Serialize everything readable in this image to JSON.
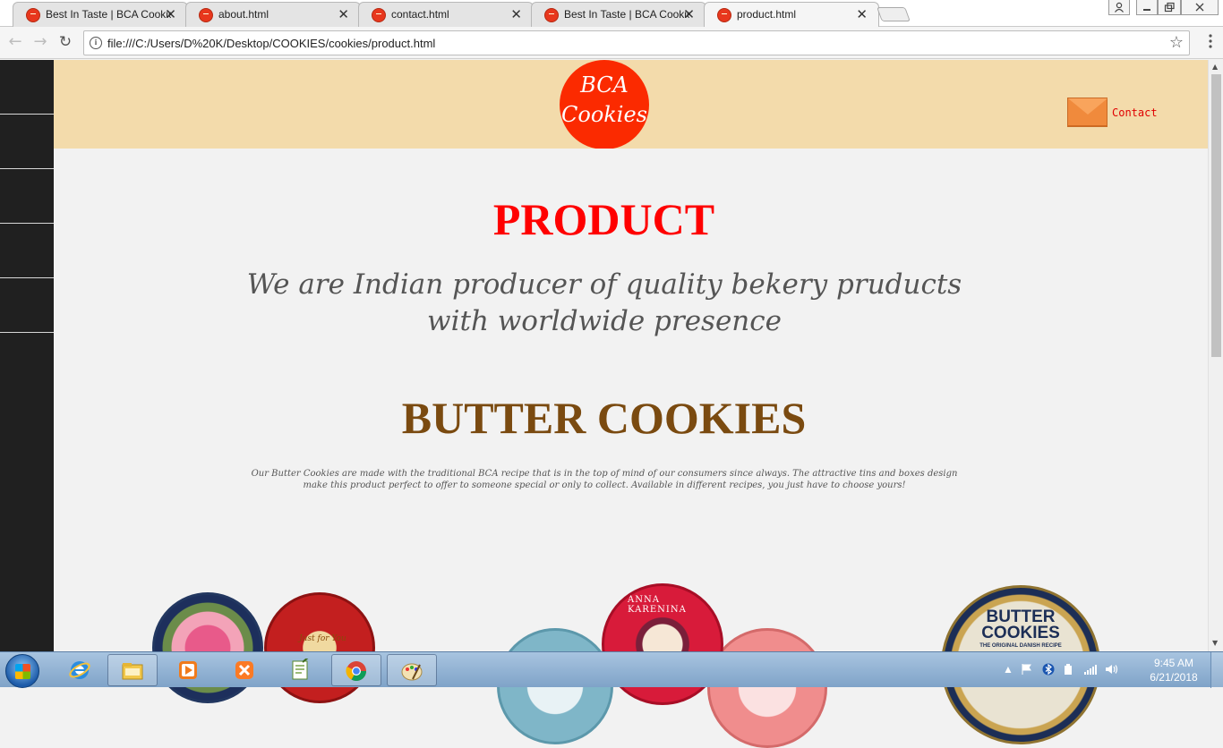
{
  "browser": {
    "tabs": [
      {
        "title": "Best In Taste | BCA Cookies",
        "active": false
      },
      {
        "title": "about.html",
        "active": false
      },
      {
        "title": "contact.html",
        "active": false
      },
      {
        "title": "Best In Taste | BCA Cookies",
        "active": false
      },
      {
        "title": "product.html",
        "active": true
      }
    ],
    "url": "file:///C:/Users/D%20K/Desktop/COOKIES/cookies/product.html",
    "close_glyph": "✕",
    "back_glyph": "←",
    "forward_glyph": "→",
    "reload_glyph": "↻",
    "info_glyph": "i",
    "star_glyph": "☆"
  },
  "site": {
    "logo_line1": "BCA",
    "logo_line2": "Cookies",
    "contact_label": "Contact",
    "sidebar_items": 5,
    "heading": "PRODUCT",
    "tagline": "We are Indian producer of quality bekery pruducts with worldwide presence",
    "section_heading": "BUTTER COOKIES",
    "description": "Our Butter Cookies are made with the traditional BCA recipe that is in the top of mind of our consumers since always. The attractive tins and boxes design make this product perfect to offer to someone special or only to collect. Available in different recipes, you just have to choose yours!",
    "tin_labels": {
      "anna": "ANNA KARENINA",
      "butter_line1": "BUTTER",
      "butter_line2": "COOKIES",
      "butter_sub": "THE ORIGINAL DANISH RECIPE",
      "just_for_you": "Just for You"
    },
    "colors": {
      "header_bg": "#f3dbab",
      "logo_bg": "#fb2a00",
      "heading": "#ff0000",
      "section_heading": "#7a4a10",
      "sidebar_bg": "#202020"
    }
  },
  "taskbar": {
    "time": "9:45 AM",
    "date": "6/21/2018",
    "apps": [
      "start-icon",
      "internet-explorer-icon",
      "file-explorer-icon",
      "media-player-icon",
      "xampp-icon",
      "notepad-plus-plus-icon",
      "chrome-icon",
      "paint-icon"
    ]
  }
}
